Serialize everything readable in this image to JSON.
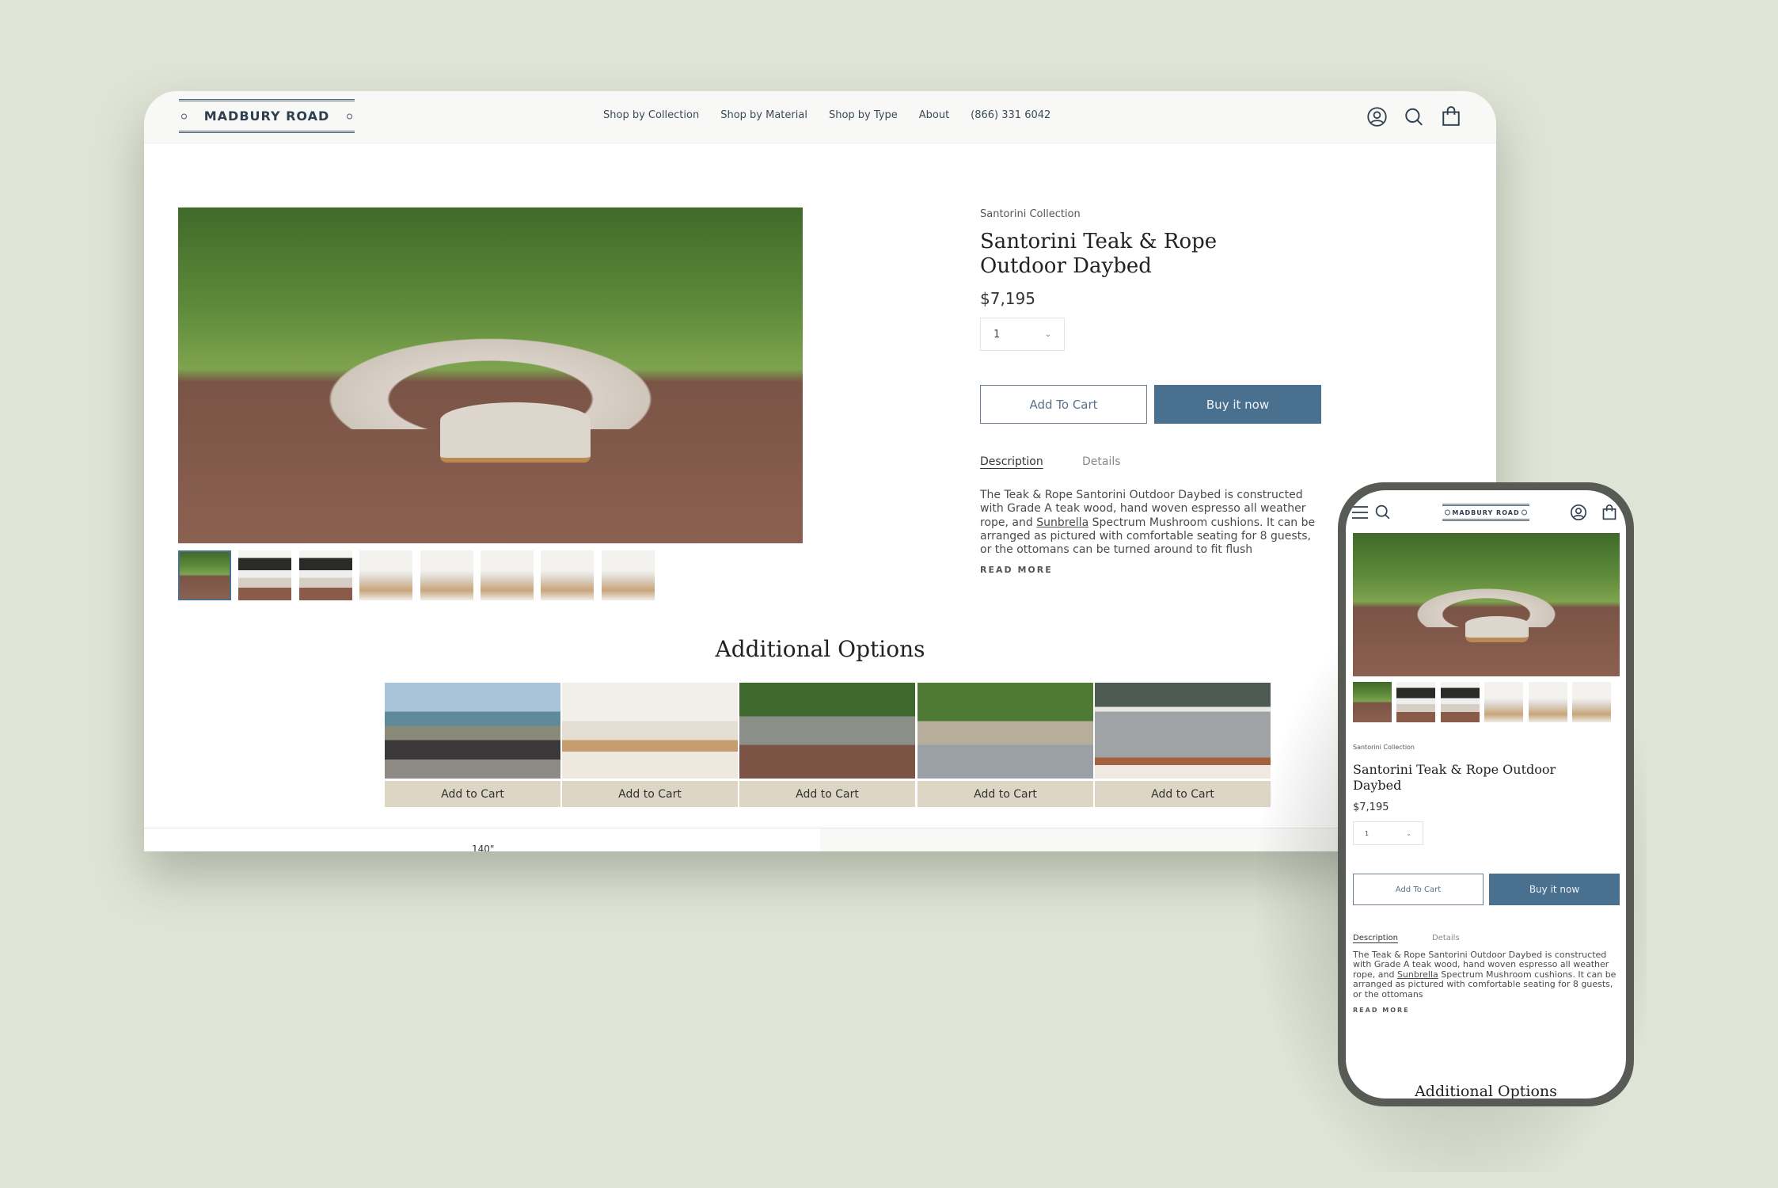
{
  "brand": {
    "logo_text": "MADBURY ROAD"
  },
  "nav": {
    "links": [
      "Shop by Collection",
      "Shop by Material",
      "Shop by Type",
      "About",
      "(866) 331 6042"
    ]
  },
  "product": {
    "collection": "Santorini Collection",
    "title": "Santorini Teak & Rope Outdoor Daybed",
    "price": "$7,195",
    "quantity": "1",
    "add_to_cart": "Add To Cart",
    "buy_now": "Buy it now",
    "tabs": [
      "Description",
      "Details"
    ],
    "active_tab": "Description",
    "desc_before_link": "The Teak & Rope Santorini Outdoor Daybed is constructed with Grade A teak wood, hand woven espresso all weather rope, and ",
    "desc_link": "Sunbrella",
    "desc_after_link": " Spectrum Mushroom cushions. It can be arranged as pictured with comfortable seating for 8 guests, or the ottomans can be turned around to fit flush",
    "mobile_desc_after_link": " Spectrum Mushroom cushions. It can be arranged as pictured with comfortable seating for 8 guests, or the ottomans",
    "read_more": "READ MORE"
  },
  "additional": {
    "heading": "Additional Options",
    "cards": [
      {
        "label": "Add to Cart"
      },
      {
        "label": "Add to Cart"
      },
      {
        "label": "Add to Cart"
      },
      {
        "label": "Add to Cart"
      },
      {
        "label": "Add to Cart"
      }
    ]
  },
  "dimension_label": "140\"",
  "colors": {
    "background": "#dfe4d6",
    "primary_button": "#4a7090",
    "card_button": "#ddd6c5",
    "logo": "#2f3f4f"
  }
}
